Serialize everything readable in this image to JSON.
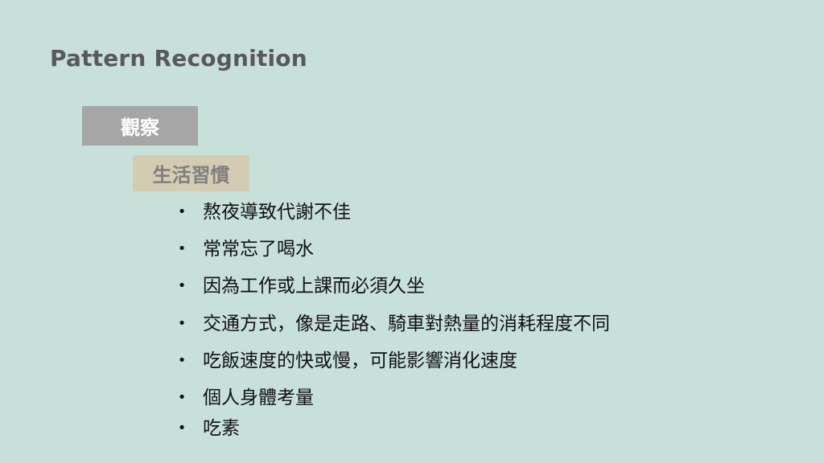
{
  "slide": {
    "title": "Pattern Recognition",
    "tag_primary": "觀察",
    "tag_secondary": "生活習慣",
    "bullet_symbol": "•",
    "items": [
      "熬夜導致代謝不佳",
      "常常忘了喝水",
      "因為工作或上課而必須久坐",
      "交通方式，像是走路、騎車對熱量的消耗程度不同",
      "吃飯速度的快或慢，可能影響消化速度",
      "個人身體考量",
      "吃素"
    ]
  },
  "colors": {
    "background": "#c8e0da",
    "title": "#595959",
    "tag_primary_bg": "#a6a6a6",
    "tag_secondary_bg": "#d4cbb3"
  }
}
